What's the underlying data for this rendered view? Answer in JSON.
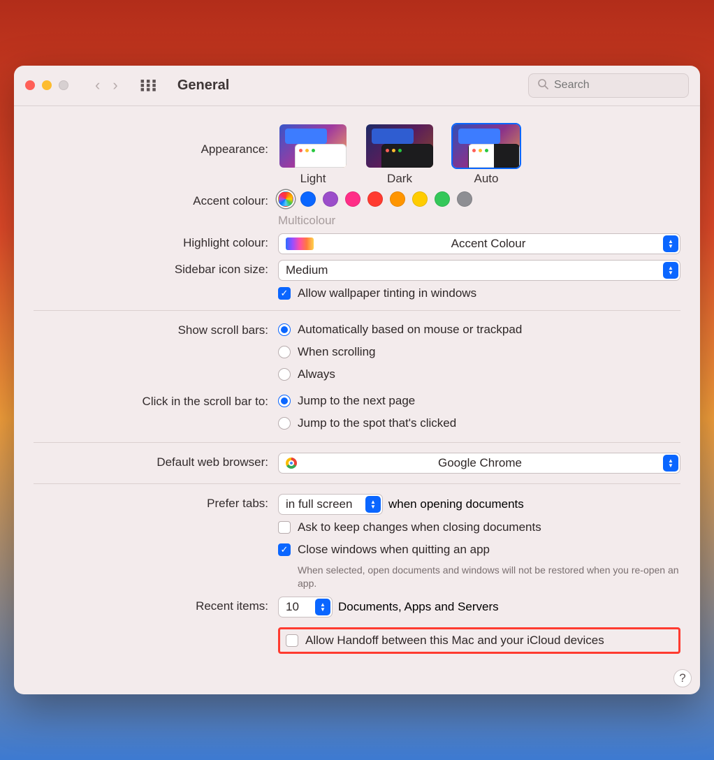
{
  "window": {
    "title": "General"
  },
  "search": {
    "placeholder": "Search"
  },
  "labels": {
    "appearance": "Appearance:",
    "accent": "Accent colour:",
    "highlight": "Highlight colour:",
    "sidebar": "Sidebar icon size:",
    "scrollbars": "Show scroll bars:",
    "clickbar": "Click in the scroll bar to:",
    "browser": "Default web browser:",
    "prefer_tabs": "Prefer tabs:",
    "recent": "Recent items:"
  },
  "appearance": {
    "options": [
      "Light",
      "Dark",
      "Auto"
    ],
    "selected": "Auto"
  },
  "accent": {
    "caption": "Multicolour",
    "colors": [
      "multi",
      "#0a66ff",
      "#9b4dca",
      "#ff2d87",
      "#ff3b30",
      "#ff9500",
      "#ffcc00",
      "#34c759",
      "#8e8e93"
    ],
    "selected_index": 0
  },
  "highlight": {
    "value": "Accent Colour"
  },
  "sidebar": {
    "value": "Medium"
  },
  "wallpaper_tinting": {
    "checked": true,
    "label": "Allow wallpaper tinting in windows"
  },
  "scrollbars": {
    "options": [
      "Automatically based on mouse or trackpad",
      "When scrolling",
      "Always"
    ],
    "selected_index": 0
  },
  "clickbar": {
    "options": [
      "Jump to the next page",
      "Jump to the spot that's clicked"
    ],
    "selected_index": 0
  },
  "browser": {
    "value": "Google Chrome"
  },
  "prefer_tabs": {
    "value": "in full screen",
    "suffix": "when opening documents"
  },
  "ask_keep_changes": {
    "checked": false,
    "label": "Ask to keep changes when closing documents"
  },
  "close_windows": {
    "checked": true,
    "label": "Close windows when quitting an app",
    "hint": "When selected, open documents and windows will not be restored when you re-open an app."
  },
  "recent": {
    "value": "10",
    "suffix": "Documents, Apps and Servers"
  },
  "handoff": {
    "checked": false,
    "label": "Allow Handoff between this Mac and your iCloud devices"
  }
}
